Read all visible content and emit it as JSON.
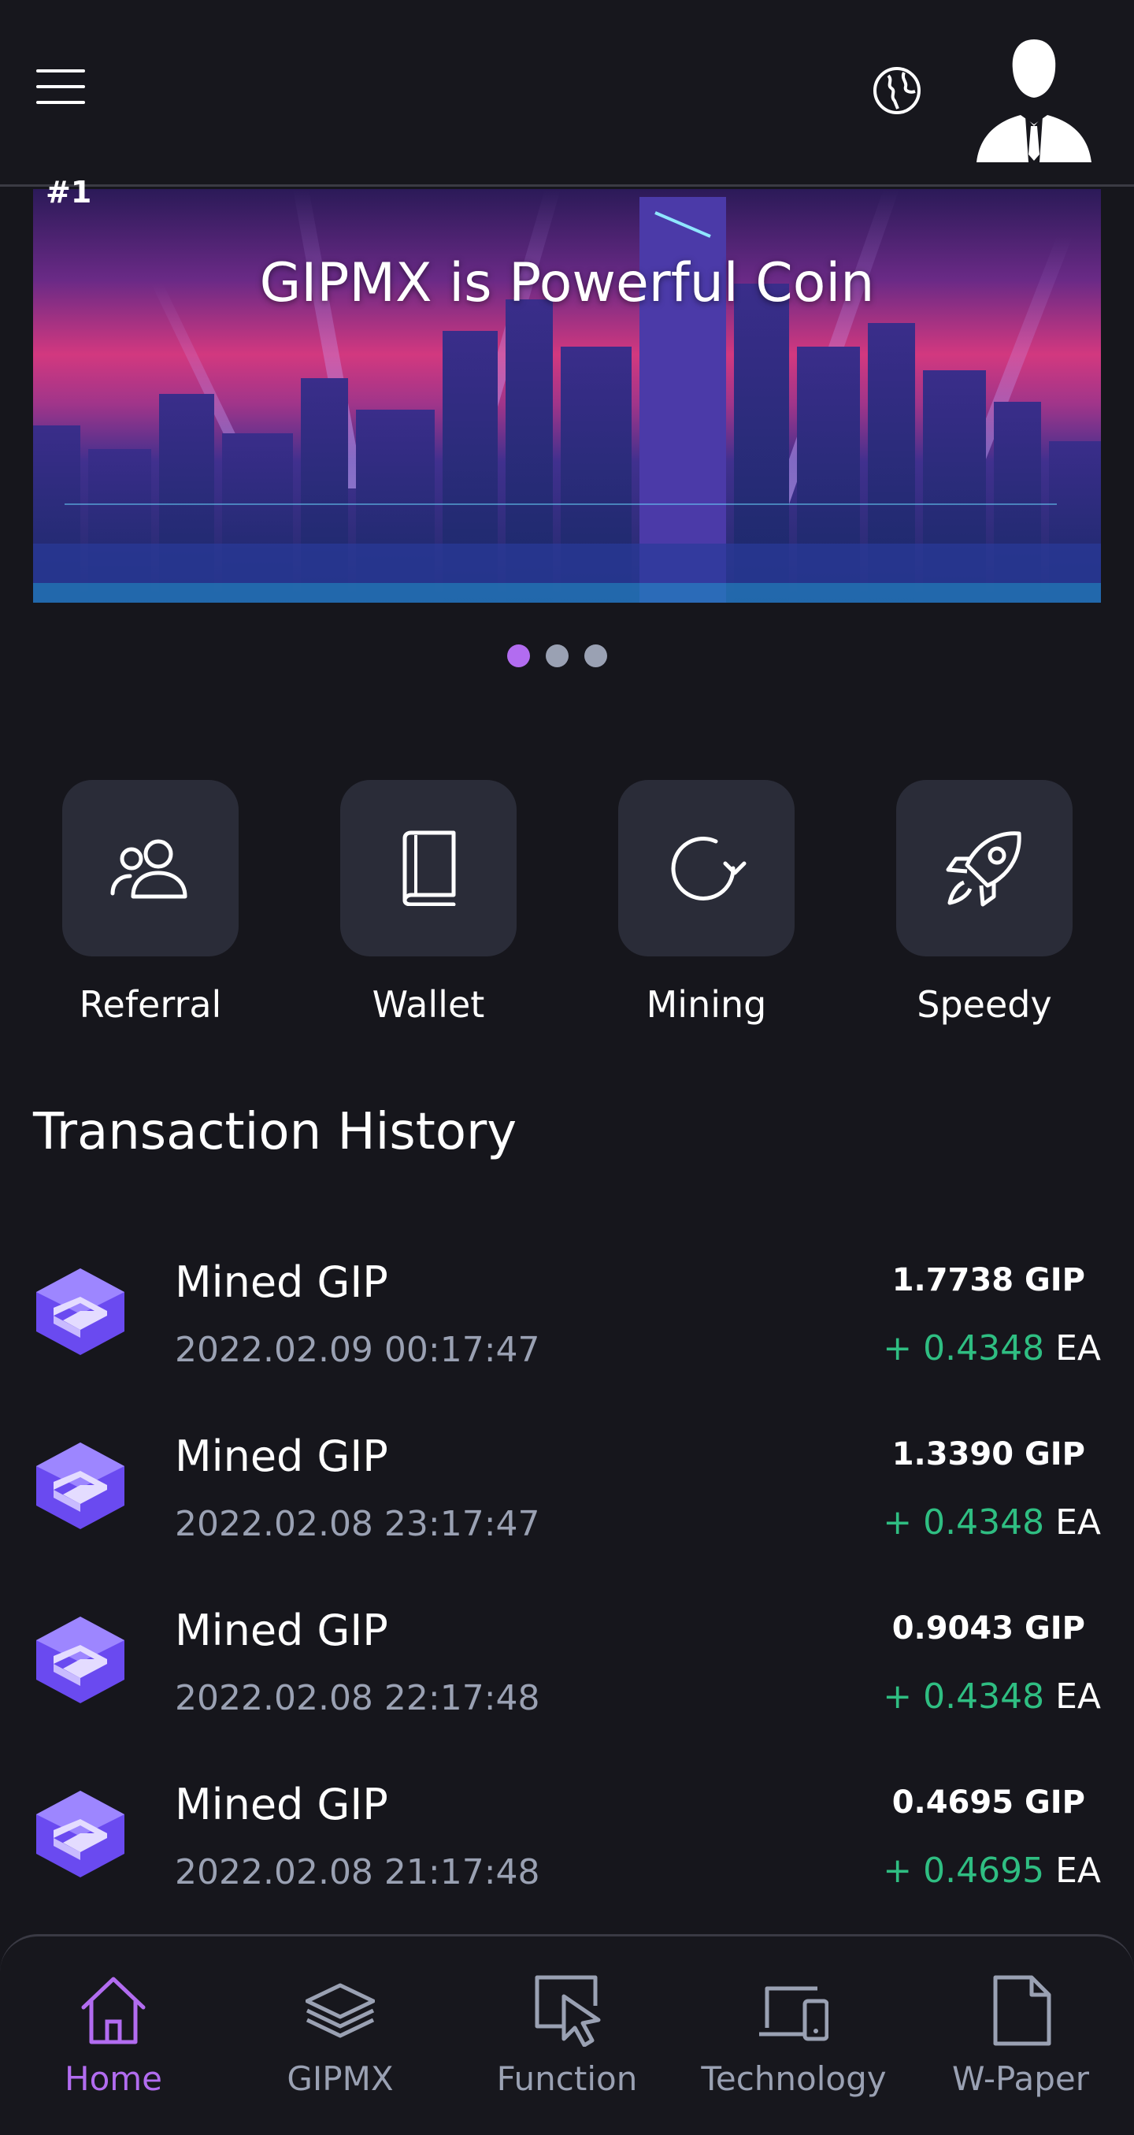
{
  "header": {
    "menu_icon": "hamburger-menu-icon",
    "globe_icon": "globe-icon",
    "avatar_icon": "user-avatar-icon"
  },
  "banner": {
    "tag": "#1",
    "title": "GIPMX is Powerful Coin",
    "slides_total": 3,
    "active_slide": 1
  },
  "quick_actions": [
    {
      "label": "Referral",
      "icon": "users-icon"
    },
    {
      "label": "Wallet",
      "icon": "book-icon"
    },
    {
      "label": "Mining",
      "icon": "refresh-icon"
    },
    {
      "label": "Speedy",
      "icon": "rocket-icon"
    }
  ],
  "transactions": {
    "title": "Transaction History",
    "items": [
      {
        "name": "Mined GIP",
        "date": "2022.02.09 00:17:47",
        "amount": "1.7738 GIP",
        "gain_prefix": "+ ",
        "gain": "0.4348",
        "unit": " EA"
      },
      {
        "name": "Mined GIP",
        "date": "2022.02.08 23:17:47",
        "amount": "1.3390 GIP",
        "gain_prefix": "+ ",
        "gain": "0.4348",
        "unit": " EA"
      },
      {
        "name": "Mined GIP",
        "date": "2022.02.08 22:17:48",
        "amount": "0.9043 GIP",
        "gain_prefix": "+ ",
        "gain": "0.4348",
        "unit": " EA"
      },
      {
        "name": "Mined GIP",
        "date": "2022.02.08 21:17:48",
        "amount": "0.4695 GIP",
        "gain_prefix": "+ ",
        "gain": "0.4695",
        "unit": " EA"
      }
    ]
  },
  "nav": [
    {
      "label": "Home",
      "icon": "home-icon",
      "active": true
    },
    {
      "label": "GIPMX",
      "icon": "layers-icon",
      "active": false
    },
    {
      "label": "Function",
      "icon": "cursor-icon",
      "active": false
    },
    {
      "label": "Technology",
      "icon": "devices-icon",
      "active": false
    },
    {
      "label": "W-Paper",
      "icon": "document-icon",
      "active": false
    }
  ],
  "colors": {
    "background": "#16161c",
    "accent": "#b26cf0",
    "gain": "#2fbe82",
    "muted": "#9aa1b3",
    "tile": "#2a2c38"
  }
}
